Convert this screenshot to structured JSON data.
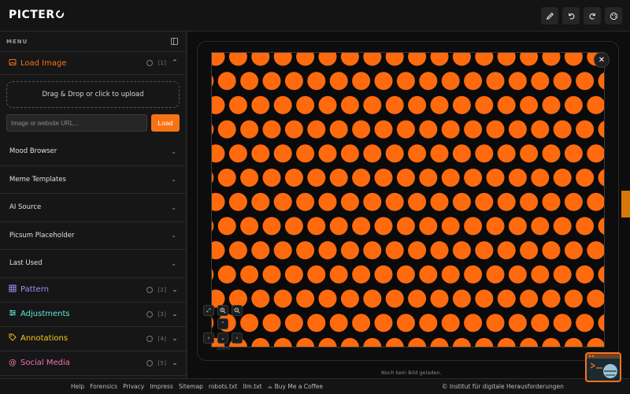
{
  "app": {
    "name_prefix": "PICTER"
  },
  "toolbar": {
    "icons": [
      "pen-icon",
      "undo-icon",
      "redo-icon",
      "palette-icon"
    ]
  },
  "sidebar": {
    "menu_label": "MENU",
    "sections": [
      {
        "title": "Load Image",
        "count": "[1]",
        "icon": "image-icon",
        "color": "#f97316",
        "expanded": true
      },
      {
        "title": "Pattern",
        "count": "[2]",
        "icon": "grid-icon",
        "color": "#a78bfa",
        "expanded": false
      },
      {
        "title": "Adjustments",
        "count": "[3]",
        "icon": "sliders-icon",
        "color": "#5eead4",
        "expanded": false
      },
      {
        "title": "Annotations",
        "count": "[4]",
        "icon": "tag-icon",
        "color": "#facc15",
        "expanded": false
      },
      {
        "title": "Social Media",
        "count": "[5]",
        "icon": "at-icon",
        "color": "#f472b6",
        "expanded": false
      }
    ],
    "load": {
      "dropzone": "Drag & Drop or click to upload",
      "url_placeholder": "Image or website URL...",
      "load_button": "Load",
      "sub_items": [
        "Mood Browser",
        "Meme Templates",
        "AI Source",
        "Picsum Placeholder",
        "Last Used"
      ]
    }
  },
  "main": {
    "status": "Noch kein Bild geladen.",
    "zoom_label": "100%",
    "pattern_colors": {
      "dot": "#ff6a0e",
      "background": "#0a0a0a"
    }
  },
  "footer": {
    "links": [
      "Help",
      "Forensics",
      "Privacy",
      "Impress",
      "Sitemap",
      "robots.txt",
      "llm.txt",
      "☕ Buy Me a Coffee"
    ],
    "copyright": "© Institut für digitale Herausforderungen"
  }
}
